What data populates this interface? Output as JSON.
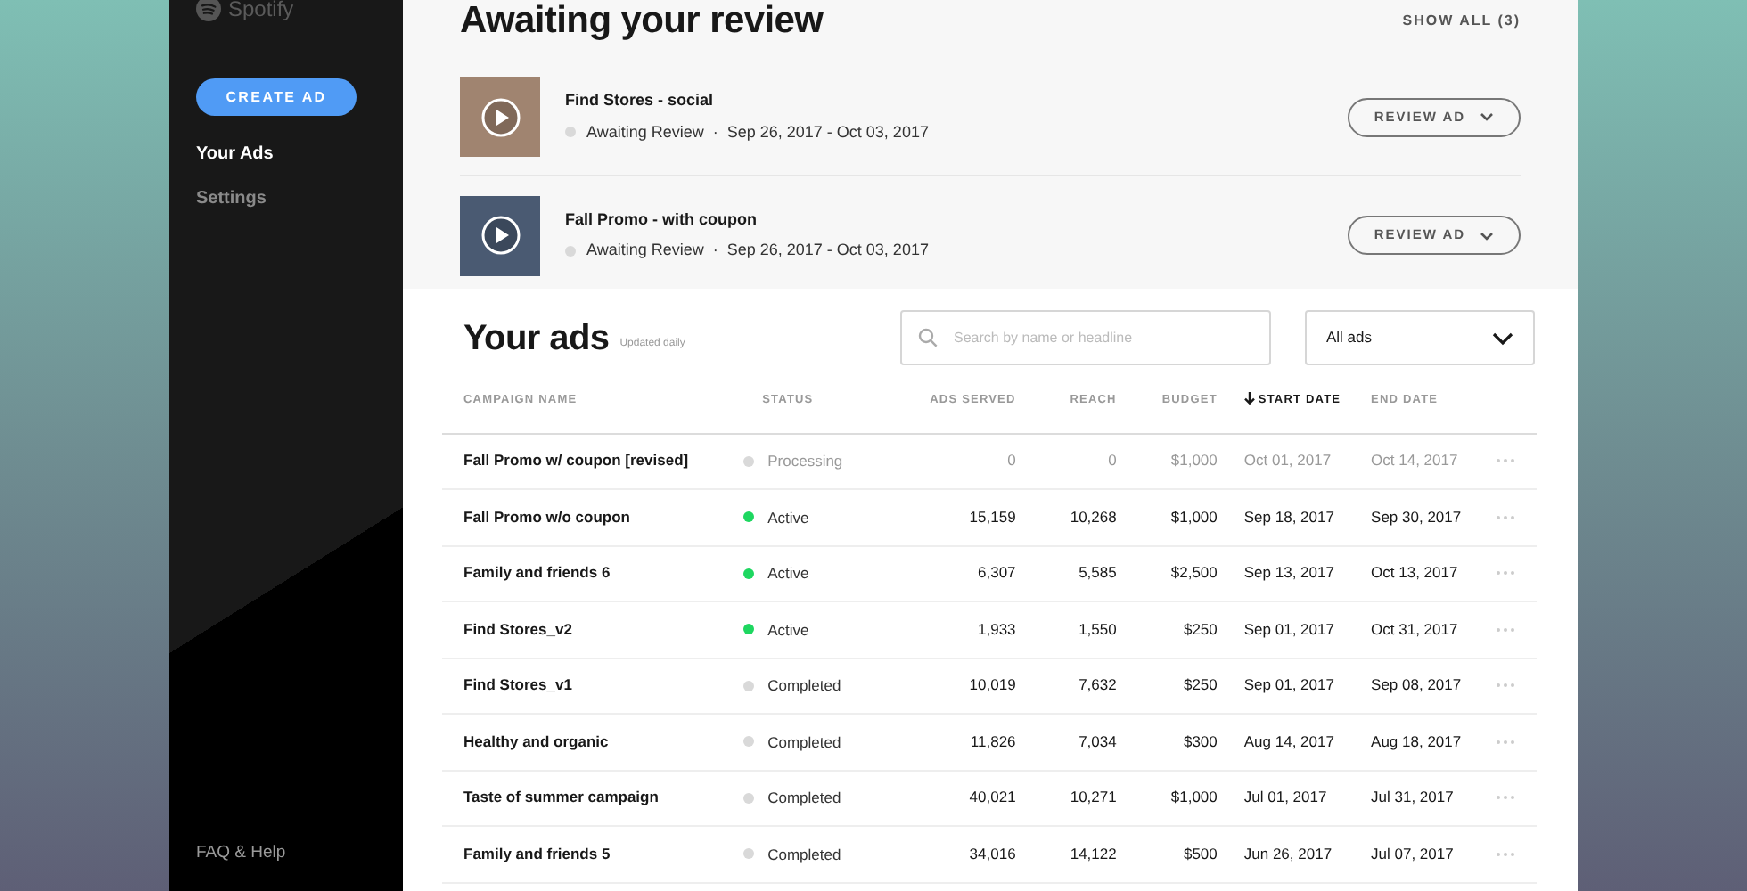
{
  "sidebar": {
    "logo": "Spotify",
    "create_button": "CREATE AD",
    "nav": [
      {
        "label": "Your Ads",
        "selected": true
      },
      {
        "label": "Settings",
        "selected": false
      }
    ],
    "footer_link": "FAQ & Help"
  },
  "review": {
    "title": "Awaiting your review",
    "show_all": "SHOW ALL (3)",
    "items": [
      {
        "name": "Find Stores - social",
        "status": "Awaiting Review",
        "separator": "·",
        "dates": "Sep 26, 2017 - Oct 03, 2017",
        "button": "REVIEW AD"
      },
      {
        "name": "Fall Promo - with coupon",
        "status": "Awaiting Review",
        "separator": "·",
        "dates": "Sep 26, 2017 - Oct 03, 2017",
        "button": "REVIEW AD"
      }
    ]
  },
  "ads": {
    "title": "Your ads",
    "subtitle": "Updated daily",
    "search": {
      "placeholder": "Search by name or headline"
    },
    "filter": "All ads",
    "columns": [
      {
        "label": "CAMPAIGN NAME",
        "sorted": false
      },
      {
        "label": "STATUS",
        "sorted": false
      },
      {
        "label": "ADS SERVED",
        "sorted": false
      },
      {
        "label": "REACH",
        "sorted": false
      },
      {
        "label": "BUDGET",
        "sorted": false
      },
      {
        "label": "START DATE",
        "sorted": true
      },
      {
        "label": "END DATE",
        "sorted": false
      }
    ],
    "rows": [
      {
        "name": "Fall Promo w/ coupon [revised]",
        "status": "Processing",
        "color": "#d9d9d9",
        "muted": true,
        "served": "0",
        "reach": "0",
        "budget": "$1,000",
        "start": "Oct 01, 2017",
        "end": "Oct 14, 2017"
      },
      {
        "name": "Fall Promo w/o coupon",
        "status": "Active",
        "color": "#1ed760",
        "muted": false,
        "served": "15,159",
        "reach": "10,268",
        "budget": "$1,000",
        "start": "Sep 18, 2017",
        "end": "Sep 30, 2017"
      },
      {
        "name": "Family and friends 6",
        "status": "Active",
        "color": "#1ed760",
        "muted": false,
        "served": "6,307",
        "reach": "5,585",
        "budget": "$2,500",
        "start": "Sep 13, 2017",
        "end": "Oct 13, 2017"
      },
      {
        "name": "Find Stores_v2",
        "status": "Active",
        "color": "#1ed760",
        "muted": false,
        "served": "1,933",
        "reach": "1,550",
        "budget": "$250",
        "start": "Sep 01, 2017",
        "end": "Oct 31, 2017"
      },
      {
        "name": "Find Stores_v1",
        "status": "Completed",
        "color": "#d9d9d9",
        "muted": false,
        "served": "10,019",
        "reach": "7,632",
        "budget": "$250",
        "start": "Sep 01, 2017",
        "end": "Sep 08, 2017"
      },
      {
        "name": "Healthy and organic",
        "status": "Completed",
        "color": "#d9d9d9",
        "muted": false,
        "served": "11,826",
        "reach": "7,034",
        "budget": "$300",
        "start": "Aug 14, 2017",
        "end": "Aug 18, 2017"
      },
      {
        "name": "Taste of summer campaign",
        "status": "Completed",
        "color": "#d9d9d9",
        "muted": false,
        "served": "40,021",
        "reach": "10,271",
        "budget": "$1,000",
        "start": "Jul 01, 2017",
        "end": "Jul 31, 2017"
      },
      {
        "name": "Family and friends 5",
        "status": "Completed",
        "color": "#d9d9d9",
        "muted": false,
        "served": "34,016",
        "reach": "14,122",
        "budget": "$500",
        "start": "Jun 26, 2017",
        "end": "Jul 07, 2017"
      }
    ]
  }
}
